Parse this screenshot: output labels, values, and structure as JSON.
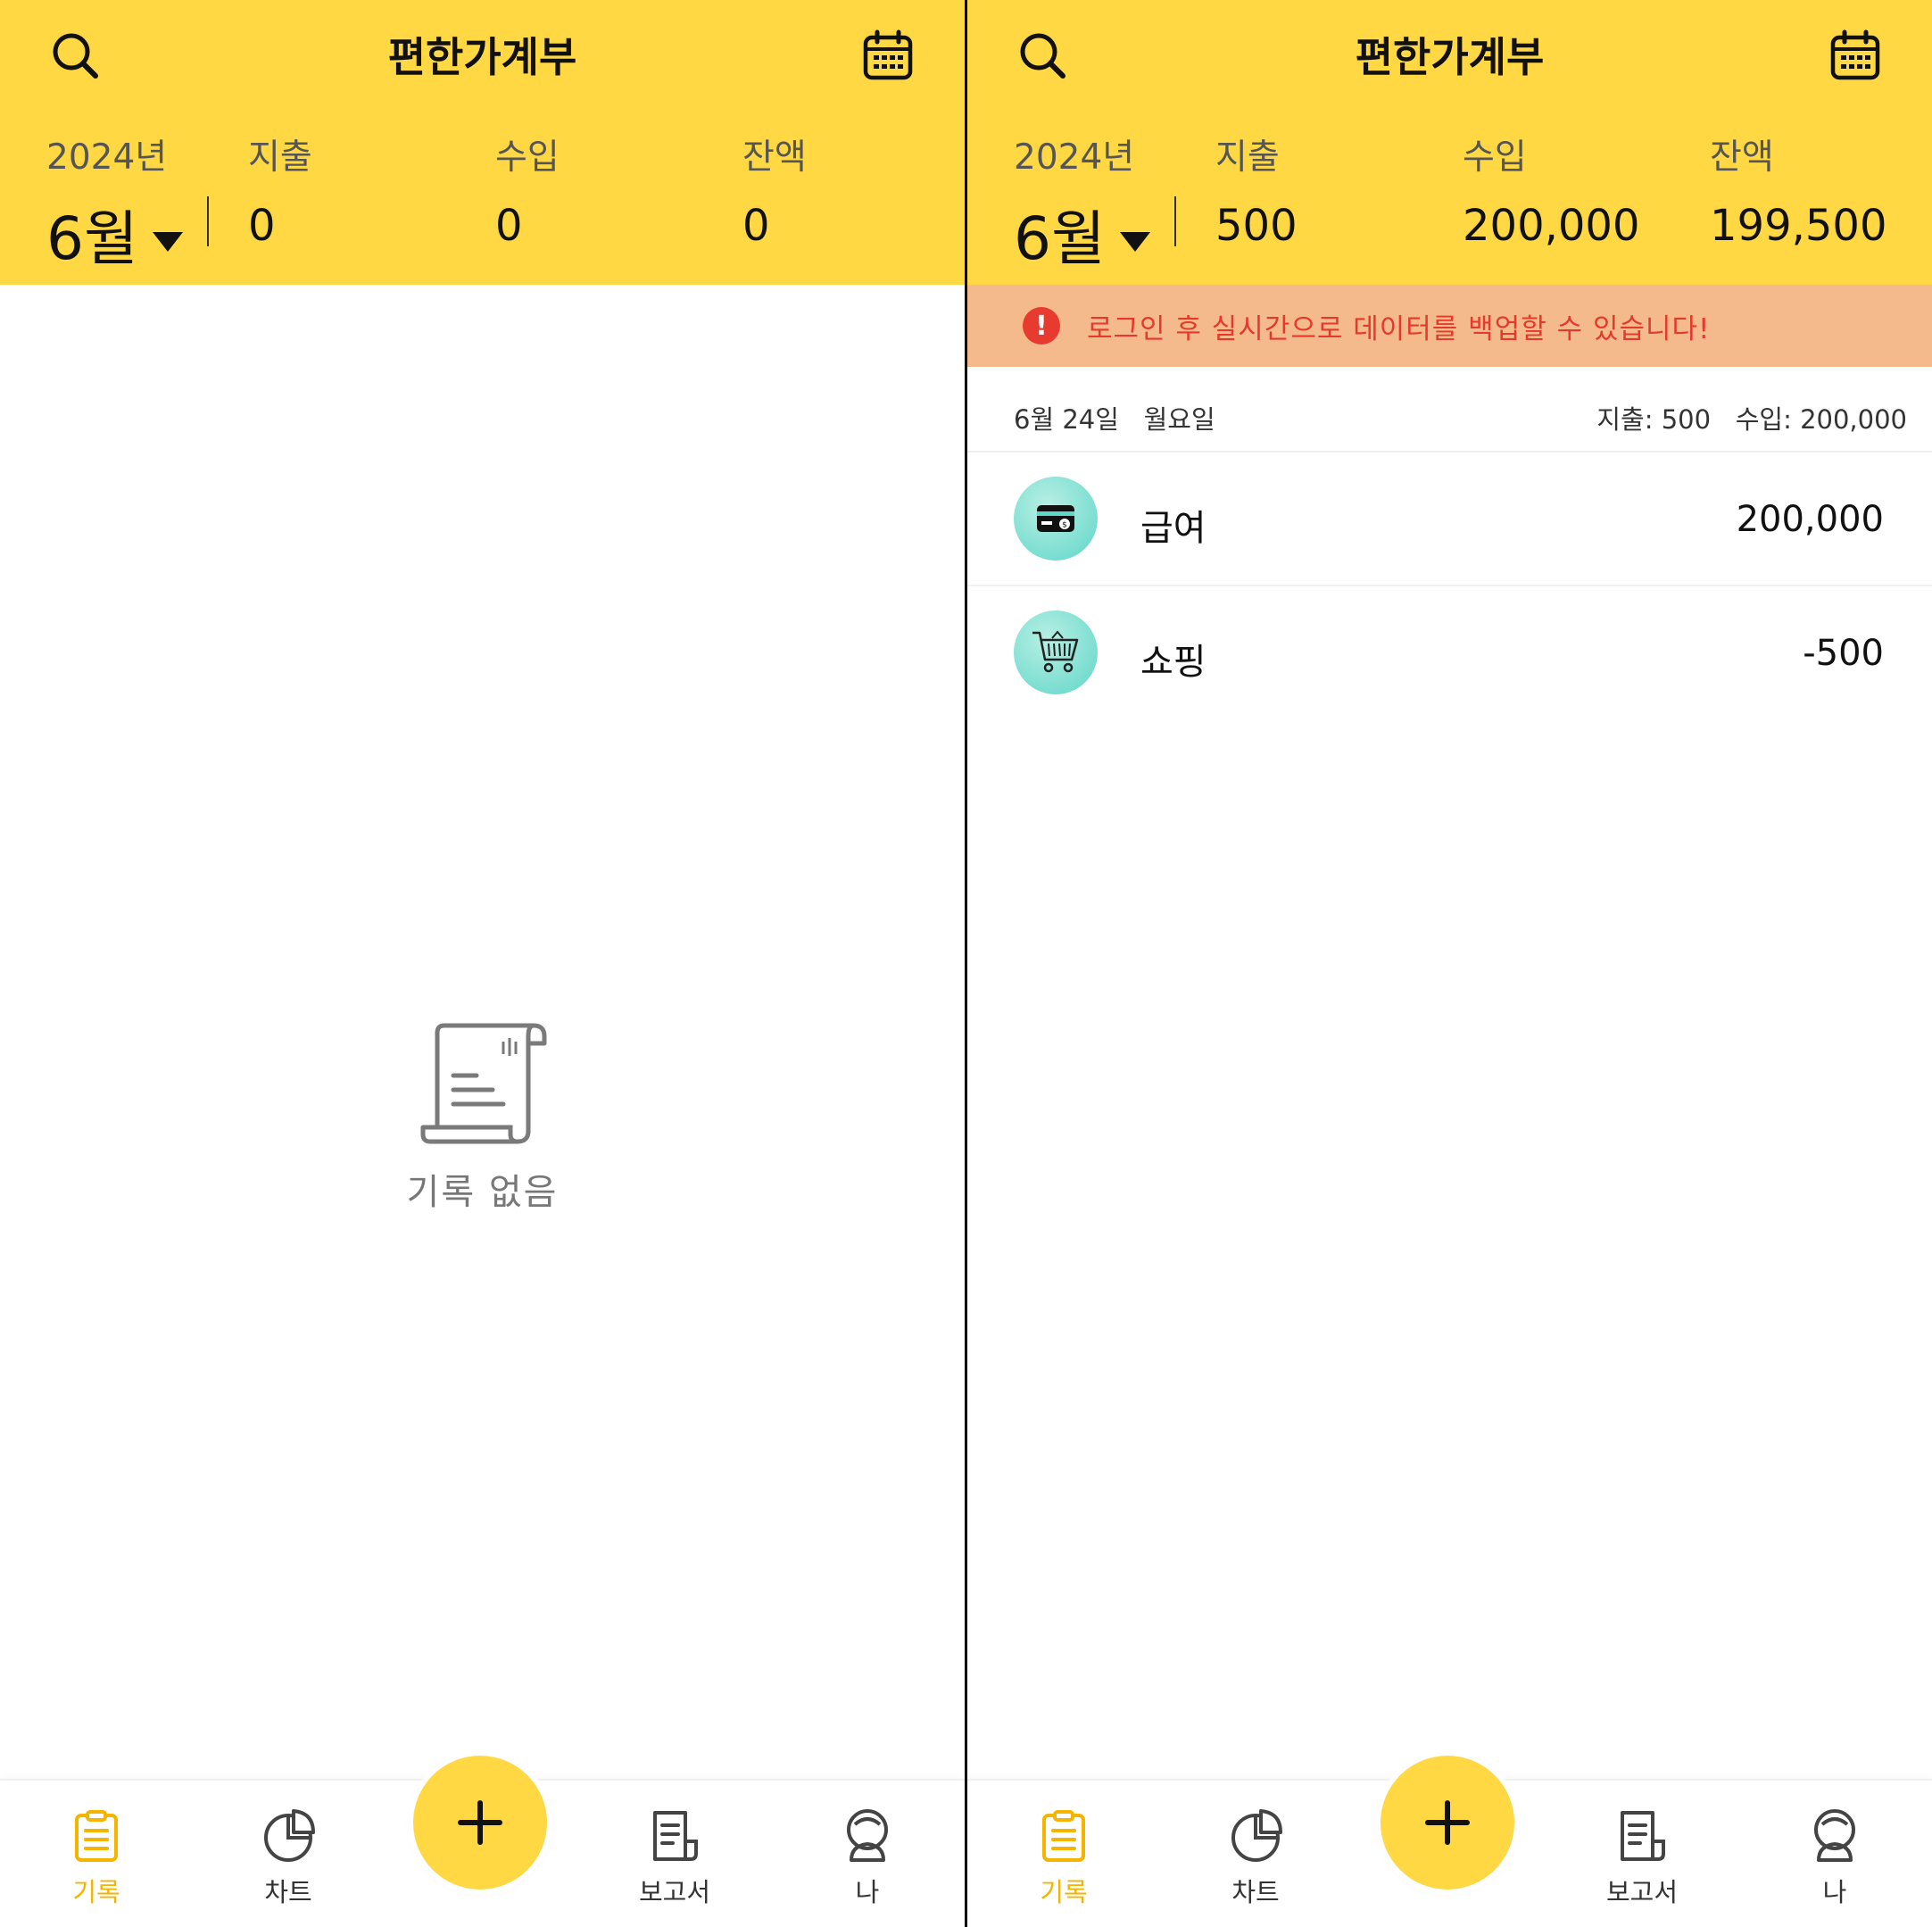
{
  "left": {
    "header": {
      "title": "편한가계부",
      "year": "2024년",
      "month": "6월",
      "expense_label": "지출",
      "income_label": "수입",
      "balance_label": "잔액",
      "expense_value": "0",
      "income_value": "0",
      "balance_value": "0"
    },
    "empty_state": {
      "text": "기록 없음"
    }
  },
  "right": {
    "header": {
      "title": "편한가계부",
      "year": "2024년",
      "month": "6월",
      "expense_label": "지출",
      "income_label": "수입",
      "balance_label": "잔액",
      "expense_value": "500",
      "income_value": "200,000",
      "balance_value": "199,500"
    },
    "banner": {
      "icon": "alert-icon",
      "text": "로그인 후 실시간으로 데이터를 백업할 수 있습니다!"
    },
    "day_group": {
      "date": "6월 24일   월요일",
      "summary": "지출: 500   수입: 200,000"
    },
    "transactions": [
      {
        "icon": "salary-card-icon",
        "name": "급여",
        "amount": "200,000"
      },
      {
        "icon": "shopping-cart-icon",
        "name": "쇼핑",
        "amount": "-500"
      }
    ]
  },
  "nav": {
    "items": [
      {
        "label": "기록",
        "icon": "record-icon",
        "active": true
      },
      {
        "label": "차트",
        "icon": "chart-icon"
      },
      {
        "label": "보고서",
        "icon": "report-icon"
      },
      {
        "label": "나",
        "icon": "profile-icon"
      }
    ],
    "fab_icon": "plus-icon"
  },
  "colors": {
    "header_bg": "#FFD843",
    "banner_bg": "#F5BA8B",
    "banner_text": "#E43A2D",
    "nav_active": "#F4B400",
    "category_icon_bg": "#5ED6C8"
  }
}
